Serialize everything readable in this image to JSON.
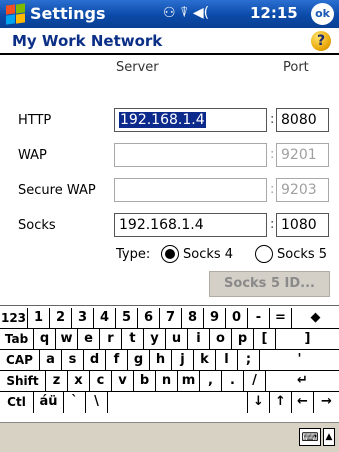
{
  "titlebar": {
    "app_title": "Settings",
    "status_icons": "⚇ ⍒ ◀(",
    "time": "12:15",
    "ok_label": "ok"
  },
  "page": {
    "title": "My Work Network",
    "help_symbol": "?"
  },
  "form": {
    "server_header": "Server",
    "port_header": "Port",
    "rows": [
      {
        "label": "HTTP",
        "server": "192.168.1.4",
        "port": "8080",
        "enabled": true,
        "server_selected": true
      },
      {
        "label": "WAP",
        "server": "",
        "port": "9201",
        "enabled": false
      },
      {
        "label": "Secure WAP",
        "server": "",
        "port": "9203",
        "enabled": false
      },
      {
        "label": "Socks",
        "server": "192.168.1.4",
        "port": "1080",
        "enabled": true
      }
    ],
    "colon": ":",
    "type_label": "Type:",
    "socks4_label": "Socks 4",
    "socks5_label": "Socks 5",
    "socks_type_selected": "Socks 4",
    "socks5_id_button": "Socks 5 ID..."
  },
  "keyboard": {
    "rows": [
      [
        "123",
        "1",
        "2",
        "3",
        "4",
        "5",
        "6",
        "7",
        "8",
        "9",
        "0",
        "-",
        "=",
        "◆"
      ],
      [
        "Tab",
        "q",
        "w",
        "e",
        "r",
        "t",
        "y",
        "u",
        "i",
        "o",
        "p",
        "[",
        "]"
      ],
      [
        "CAP",
        "a",
        "s",
        "d",
        "f",
        "g",
        "h",
        "j",
        "k",
        "l",
        ";",
        "'"
      ],
      [
        "Shift",
        "z",
        "x",
        "c",
        "v",
        "b",
        "n",
        "m",
        ",",
        ".",
        "/",
        "↵"
      ],
      [
        "Ctl",
        "áü",
        "`",
        "\\",
        "",
        "↓",
        "↑",
        "←",
        "→"
      ]
    ],
    "input_icon": "⌨",
    "input_arrow": "▲"
  }
}
